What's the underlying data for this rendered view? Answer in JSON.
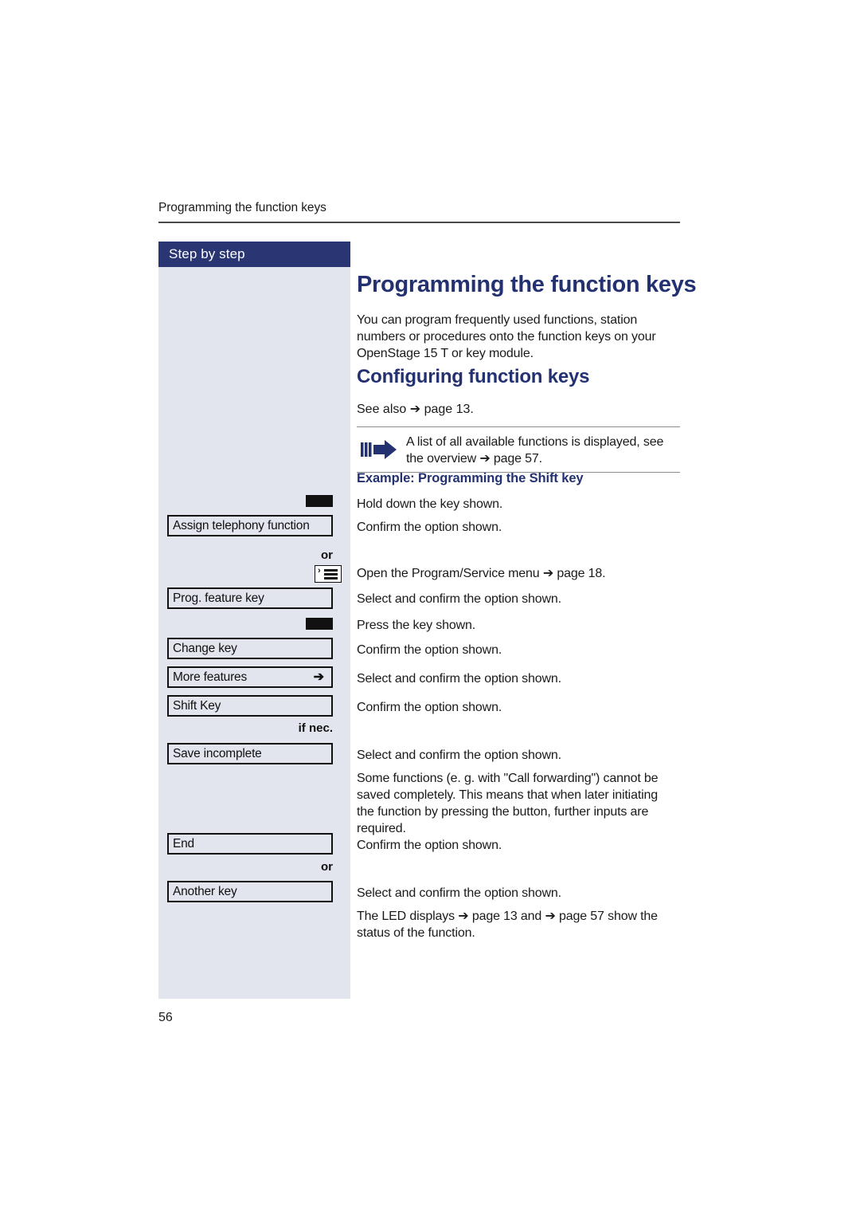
{
  "document": {
    "running_header": "Programming the function keys",
    "page_number": "56"
  },
  "sidebar": {
    "header_label": "Step by step",
    "or_label_1": "or",
    "or_label_2": "or",
    "if_nec_label": "if nec.",
    "options": [
      {
        "label": "Assign telephony function",
        "arrow": ""
      },
      {
        "label": "Prog. feature key",
        "arrow": ""
      },
      {
        "label": "Change key",
        "arrow": ""
      },
      {
        "label": "More features",
        "arrow": "➔"
      },
      {
        "label": "Shift Key",
        "arrow": ""
      },
      {
        "label": "Save incomplete",
        "arrow": ""
      },
      {
        "label": "End",
        "arrow": ""
      },
      {
        "label": "Another key",
        "arrow": ""
      }
    ],
    "icons": {
      "key_glyph_1": "telephony-key-icon",
      "key_glyph_2": "telephony-key-icon",
      "menu_glyph": "program-service-menu-icon",
      "menu_caret": "›"
    }
  },
  "content": {
    "title": "Programming the function keys",
    "intro": "You can program frequently used functions, station numbers or procedures onto the function keys on your OpenStage 15 T or key module.",
    "subtitle": "Configuring function keys",
    "see_also": "See also ➔ page 13.",
    "note": {
      "icon_name": "note-arrow-icon",
      "text": "A list of all available functions is displayed, see the overview ➔ page 57."
    },
    "example_heading": "Example: Programming the Shift key",
    "steps": [
      "Hold down the key shown.",
      "Confirm the option shown.",
      "Open the Program/Service menu ➔ page 18.",
      "Select and confirm the option shown.",
      "Press the key shown.",
      "Confirm the option shown.",
      "Select and confirm the option shown.",
      "Confirm the option shown.",
      "Select and confirm the option shown.",
      "Some functions (e. g. with \"Call forwarding\") cannot be saved completely. This means  that when later initiating the function by pressing the button, further inputs are required.",
      "Confirm the option shown.",
      "Select and confirm the option shown.",
      "The LED displays ➔ page 13 and ➔ page 57 show the status of the function."
    ]
  },
  "colors": {
    "brand_navy": "#243171",
    "sidebar_header": "#2a3573",
    "sidebar_bg": "#e2e4ee",
    "rule": "#8c8c8c"
  }
}
